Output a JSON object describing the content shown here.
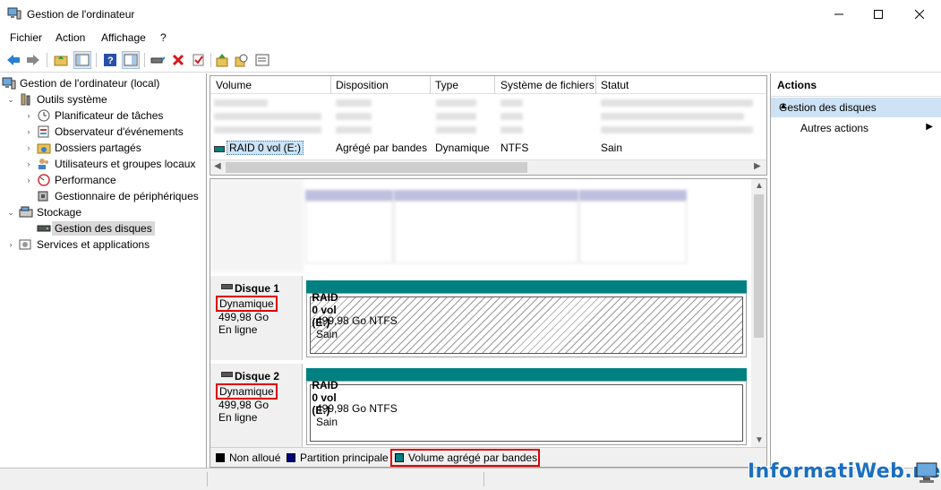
{
  "window": {
    "title": "Gestion de l'ordinateur"
  },
  "menu": [
    "Fichier",
    "Action",
    "Affichage",
    "?"
  ],
  "toolbar": [
    "back-icon",
    "forward-icon",
    "up-folder-icon",
    "show-tree-icon",
    "help-icon",
    "console-icon",
    "connect-icon",
    "delete-icon",
    "check-icon",
    "export-icon",
    "search-icon",
    "properties-icon"
  ],
  "tree": {
    "root": "Gestion de l'ordinateur (local)",
    "system_tools": "Outils système",
    "task_scheduler": "Planificateur de tâches",
    "event_viewer": "Observateur d'événements",
    "shared_folders": "Dossiers partagés",
    "local_users": "Utilisateurs et groupes locaux",
    "performance": "Performance",
    "device_manager": "Gestionnaire de périphériques",
    "storage": "Stockage",
    "disk_management": "Gestion des disques",
    "services": "Services et applications"
  },
  "volume_list": {
    "headers": [
      "Volume",
      "Disposition",
      "Type",
      "Système de fichiers",
      "Statut"
    ],
    "selected_row": {
      "volume": "RAID 0 vol (E:)",
      "layout": "Agrégé par bandes",
      "type": "Dynamique",
      "fs": "NTFS",
      "status": "Sain"
    }
  },
  "disks": [
    {
      "name": "Disque 1",
      "type": "Dynamique",
      "size": "499,98 Go",
      "state": "En ligne",
      "volume": {
        "name": "RAID 0 vol  (E:)",
        "size_fs": "499,98 Go NTFS",
        "status": "Sain"
      }
    },
    {
      "name": "Disque 2",
      "type": "Dynamique",
      "size": "499,98 Go",
      "state": "En ligne",
      "volume": {
        "name": "RAID 0 vol  (E:)",
        "size_fs": "499,98 Go NTFS",
        "status": "Sain"
      }
    }
  ],
  "legend": [
    {
      "label": "Non alloué",
      "color": "#000000"
    },
    {
      "label": "Partition principale",
      "color": "#000080"
    },
    {
      "label": "Volume agrégé par bandes",
      "color": "#008080"
    }
  ],
  "actions": {
    "header": "Actions",
    "section": "Gestion des disques",
    "more": "Autres actions"
  },
  "watermark": "InformatiWeb.net"
}
